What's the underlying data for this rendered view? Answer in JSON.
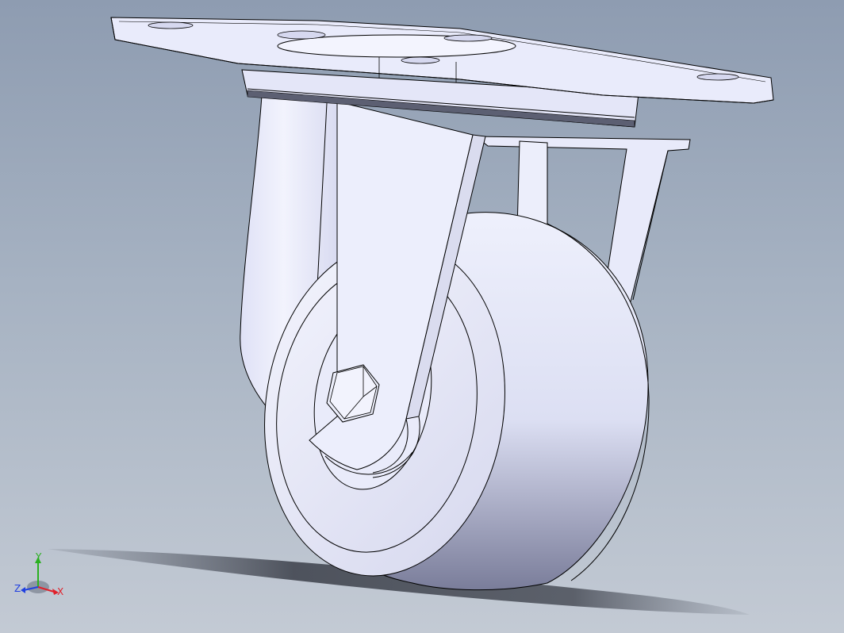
{
  "viewport": {
    "background_top": "#8e9cb1",
    "background_bottom": "#c3cad4",
    "model_color": "#e6e8fa",
    "edge_color": "#000000"
  },
  "model": {
    "parts": [
      "top-mounting-plate",
      "swivel-bearing",
      "fork-leg-rear",
      "fork-leg-front",
      "axle-hex-bolt",
      "wheel-hub",
      "wheel-tread"
    ]
  },
  "triad": {
    "x_label": "X",
    "y_label": "Y",
    "z_label": "Z",
    "x_color": "#e0202a",
    "y_color": "#2ab020",
    "z_color": "#2040e0"
  }
}
